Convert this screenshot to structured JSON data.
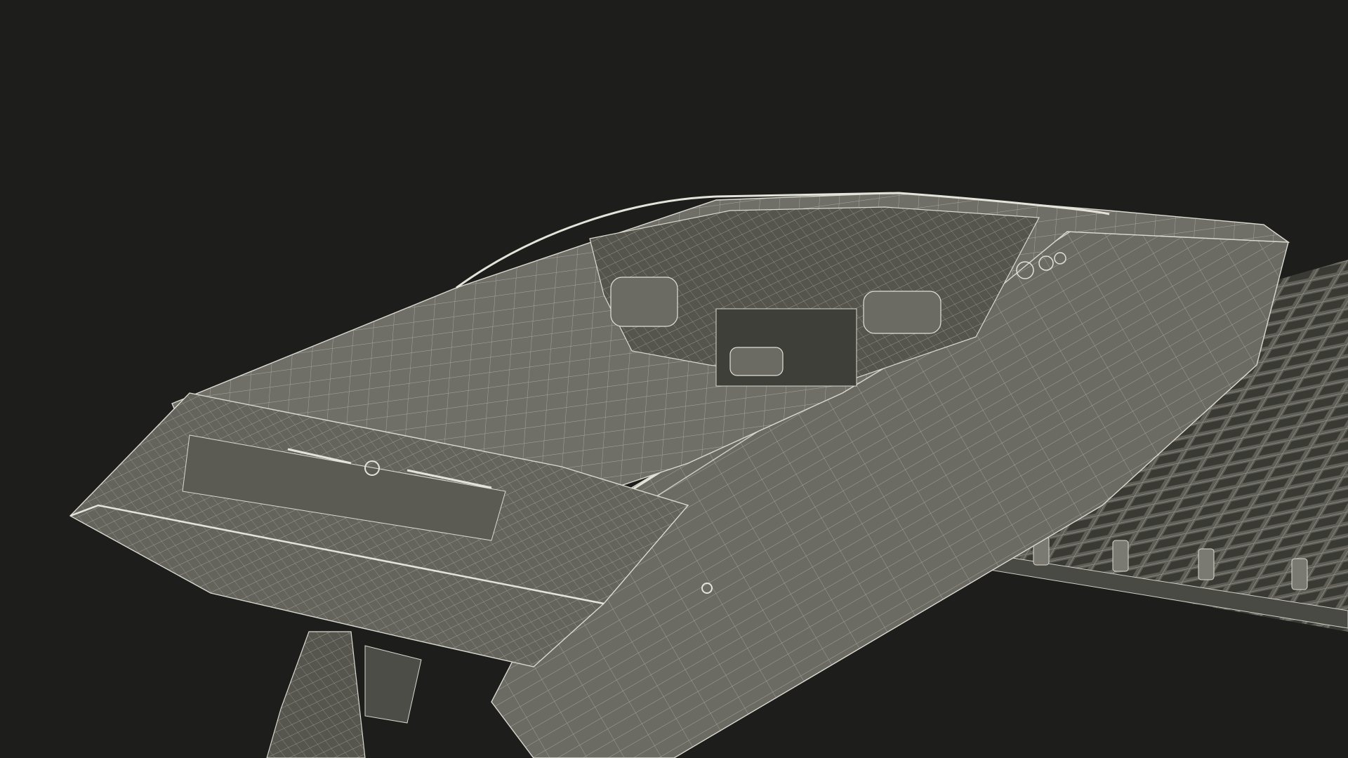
{
  "scene": {
    "subject": "speedboat-wireframe",
    "secondary": "floating-dock-wireframe",
    "colors": {
      "background": "#1d1d1c",
      "surface": "#6b6b64",
      "surface_dark": "#56564f",
      "surface_shadow": "#3f3f3a",
      "wire": "#d9d9cf"
    }
  }
}
